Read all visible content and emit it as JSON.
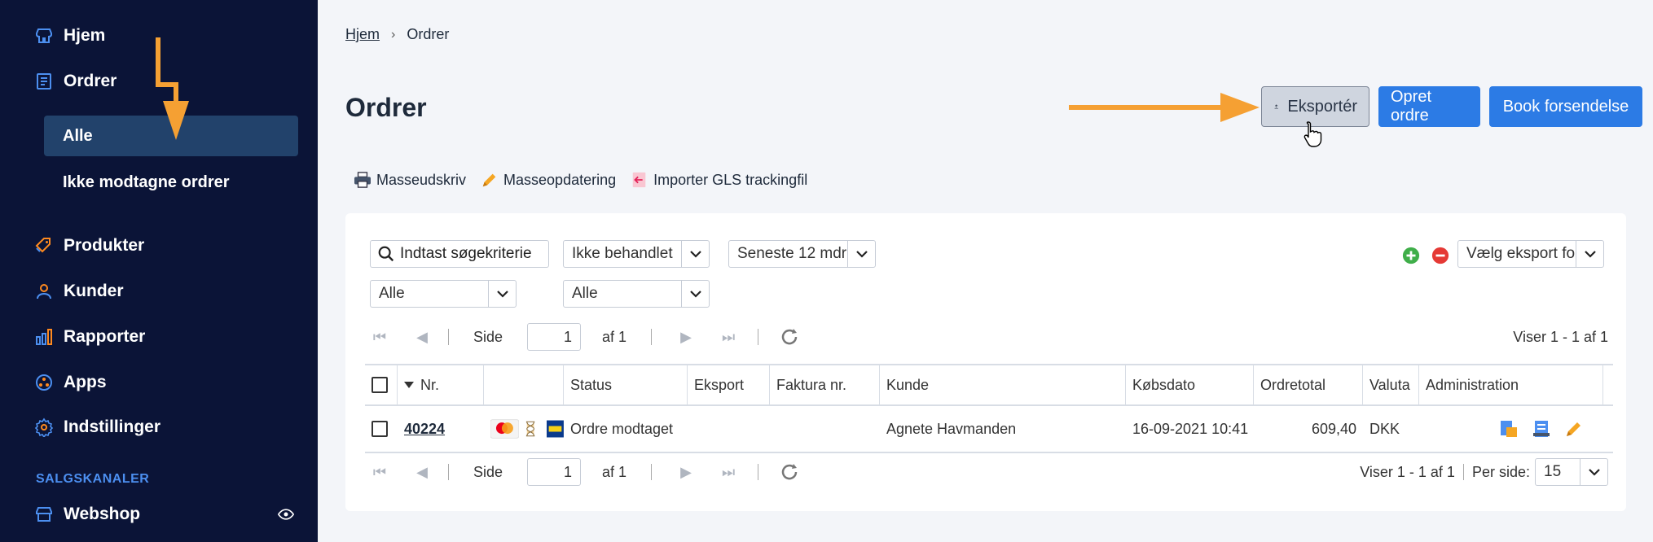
{
  "sidebar": {
    "items": [
      {
        "label": "Hjem",
        "icon": "store-icon"
      },
      {
        "label": "Ordrer",
        "icon": "receipt-icon"
      },
      {
        "label": "Produkter",
        "icon": "tag-icon"
      },
      {
        "label": "Kunder",
        "icon": "user-icon"
      },
      {
        "label": "Rapporter",
        "icon": "bar-chart-icon"
      },
      {
        "label": "Apps",
        "icon": "apps-icon"
      },
      {
        "label": "Indstillinger",
        "icon": "gear-icon"
      }
    ],
    "sub_items": [
      {
        "label": "Alle",
        "active": true
      },
      {
        "label": "Ikke modtagne ordrer",
        "active": false
      }
    ],
    "section_label": "SALGSKANALER",
    "channel": {
      "label": "Webshop",
      "icon": "store-icon"
    }
  },
  "breadcrumb": {
    "home": "Hjem",
    "current": "Ordrer"
  },
  "page_title": "Ordrer",
  "buttons": {
    "export": "Eksportér",
    "create": "Opret ordre",
    "book": "Book forsendelse"
  },
  "toolbar": {
    "print": "Masseudskriv",
    "update": "Masseopdatering",
    "import": "Importer GLS trackingfil"
  },
  "filters": {
    "search_placeholder": "Indtast søgekriterie",
    "status": "Ikke behandlet",
    "period": "Seneste 12 mdr",
    "filter_a": "Alle",
    "filter_b": "Alle",
    "export_format": "Vælg eksport format"
  },
  "pager": {
    "side_label": "Side",
    "page": "1",
    "of_label": "af 1",
    "showing": "Viser 1 - 1 af 1",
    "per_page_label": "Per side:",
    "per_page": "15"
  },
  "table": {
    "headers": [
      "Nr.",
      "Status",
      "Eksport",
      "Faktura nr.",
      "Kunde",
      "Købsdato",
      "Ordretotal",
      "Valuta",
      "Administration"
    ],
    "rows": [
      {
        "nr": "40224",
        "status": "Ordre modtaget",
        "eksport": "",
        "faktura": "",
        "kunde": "Agnete Havmanden",
        "dato": "16-09-2021 10:41",
        "total": "609,40",
        "valuta": "DKK"
      }
    ]
  },
  "colors": {
    "sidebar_bg": "#0b1437",
    "active_bg": "#22426b",
    "primary": "#2c7be5",
    "arrow": "#f5a033",
    "accent_icon": "#ff8a1f"
  }
}
